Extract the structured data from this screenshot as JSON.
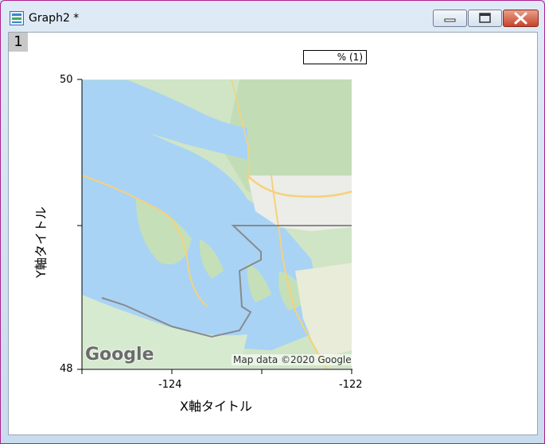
{
  "window": {
    "title": "Graph2 *",
    "layer_label": "1"
  },
  "legend": {
    "text": "% (1)"
  },
  "axes": {
    "xlabel": "X軸タイトル",
    "ylabel": "Y軸タイトル",
    "x_ticks": [
      "-124",
      "-122"
    ],
    "y_ticks": [
      "50",
      "48"
    ]
  },
  "map": {
    "credit": "Map data ©2020 Google",
    "logo": "Google"
  },
  "colors": {
    "water": "#a8d3f5",
    "land": "#cfe5c5",
    "urban": "#eeeeee",
    "road": "#f5d27a",
    "border": "#8a8a8a"
  }
}
